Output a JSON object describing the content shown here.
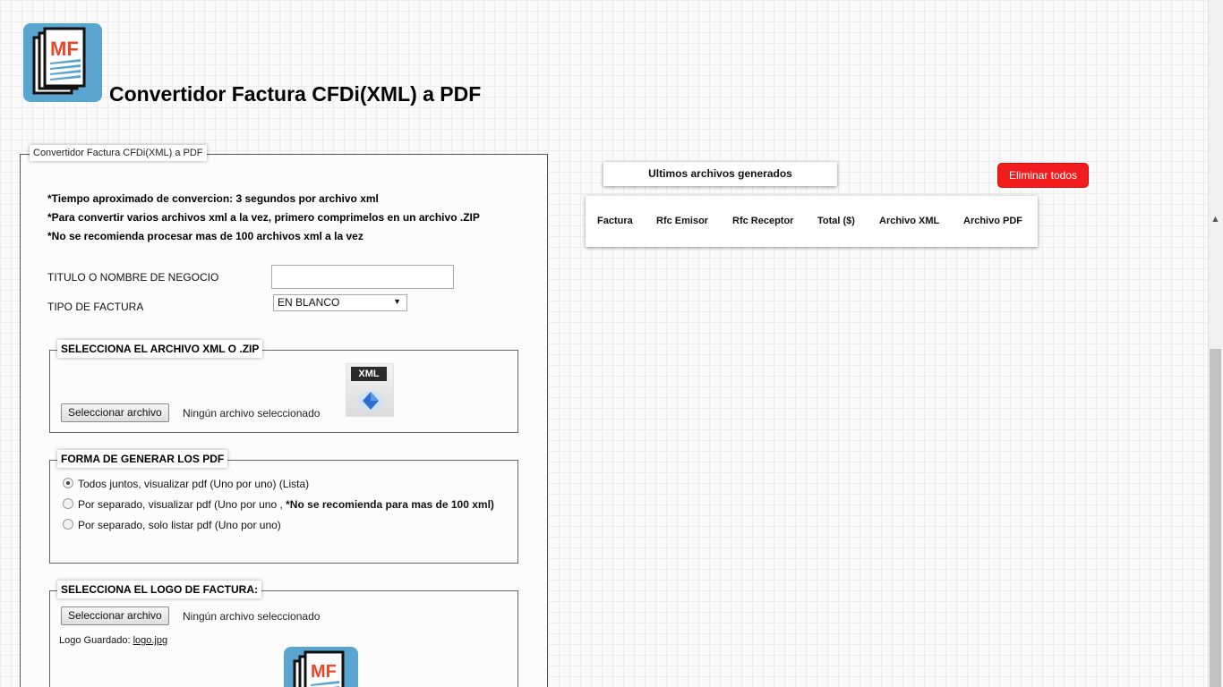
{
  "header": {
    "logo_text": "MF",
    "title": "Convertidor Factura CFDi(XML) a PDF"
  },
  "form": {
    "legend": "Convertidor Factura CFDi(XML) a PDF",
    "notes": [
      "*Tiempo aproximado de convercion: 3 segundos por archivo xml",
      "*Para convertir varios archivos xml a la vez, primero comprimelos en un archivo .ZIP",
      "*No se recomienda procesar mas de 100 archivos xml a la vez"
    ],
    "title_label": "TITULO O NOMBRE DE NEGOCIO",
    "title_value": "",
    "tipo_label": "TIPO DE FACTURA",
    "tipo_selected": "EN BLANCO"
  },
  "xml_upload": {
    "legend": "SELECCIONA EL ARCHIVO XML O .ZIP",
    "button": "Seleccionar archivo",
    "status": "Ningún archivo seleccionado",
    "icon_label": "XML"
  },
  "pdf_mode": {
    "legend": "FORMA DE GENERAR LOS PDF",
    "options": [
      {
        "label": "Todos juntos, visualizar pdf (Uno por uno) (Lista)",
        "note": "",
        "checked": true
      },
      {
        "label": "Por separado, visualizar pdf (Uno por uno ,",
        "note": "*No se recomienda para mas de 100 xml)",
        "checked": false
      },
      {
        "label": "Por separado, solo listar pdf (Uno por uno)",
        "note": "",
        "checked": false
      }
    ]
  },
  "logo_upload": {
    "legend": "SELECCIONA EL LOGO DE FACTURA:",
    "button": "Seleccionar archivo",
    "status": "Ningún archivo seleccionado",
    "saved_label": "Logo Guardado:",
    "saved_file": "logo.jpg",
    "preview_text": "MF"
  },
  "recent": {
    "title": "Ultimos archivos generados",
    "delete_all": "Eliminar todos",
    "columns": [
      "Factura",
      "Rfc Emisor",
      "Rfc Receptor",
      "Total ($)",
      "Archivo XML",
      "Archivo PDF"
    ]
  },
  "colors": {
    "logo_blue": "#5aa5d0",
    "logo_red": "#e8472b",
    "danger": "#f11c1c"
  }
}
